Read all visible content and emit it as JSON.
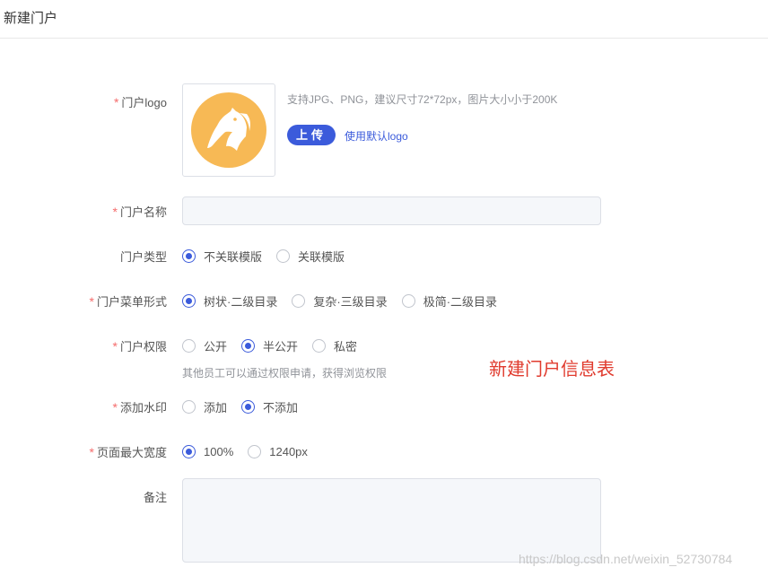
{
  "header": {
    "title": "新建门户"
  },
  "form": {
    "logo": {
      "label": "门户logo",
      "hint": "支持JPG、PNG，建议尺寸72*72px，图片大小小于200K",
      "upload_label": "上传",
      "default_link": "使用默认logo"
    },
    "name": {
      "label": "门户名称",
      "value": "",
      "placeholder": ""
    },
    "type": {
      "label": "门户类型",
      "options": [
        {
          "label": "不关联模版",
          "selected": true
        },
        {
          "label": "关联模版",
          "selected": false
        }
      ]
    },
    "menu": {
      "label": "门户菜单形式",
      "options": [
        {
          "label": "树状·二级目录",
          "selected": true
        },
        {
          "label": "复杂·三级目录",
          "selected": false
        },
        {
          "label": "极简·二级目录",
          "selected": false
        }
      ]
    },
    "permission": {
      "label": "门户权限",
      "options": [
        {
          "label": "公开",
          "selected": false
        },
        {
          "label": "半公开",
          "selected": true
        },
        {
          "label": "私密",
          "selected": false
        }
      ],
      "hint": "其他员工可以通过权限申请，获得浏览权限"
    },
    "watermark": {
      "label": "添加水印",
      "options": [
        {
          "label": "添加",
          "selected": false
        },
        {
          "label": "不添加",
          "selected": true
        }
      ]
    },
    "width": {
      "label": "页面最大宽度",
      "options": [
        {
          "label": "100%",
          "selected": true
        },
        {
          "label": "1240px",
          "selected": false
        }
      ]
    },
    "remark": {
      "label": "备注",
      "value": ""
    }
  },
  "annotation": "新建门户信息表",
  "page_watermark": "https://blog.csdn.net/weixin_52730784",
  "colors": {
    "accent": "#3b5bdb",
    "required": "#f56c6c",
    "logo": "#f7b955",
    "annotation": "#e03b2e"
  },
  "icons": {
    "logo": "horse-head-logo-icon"
  }
}
